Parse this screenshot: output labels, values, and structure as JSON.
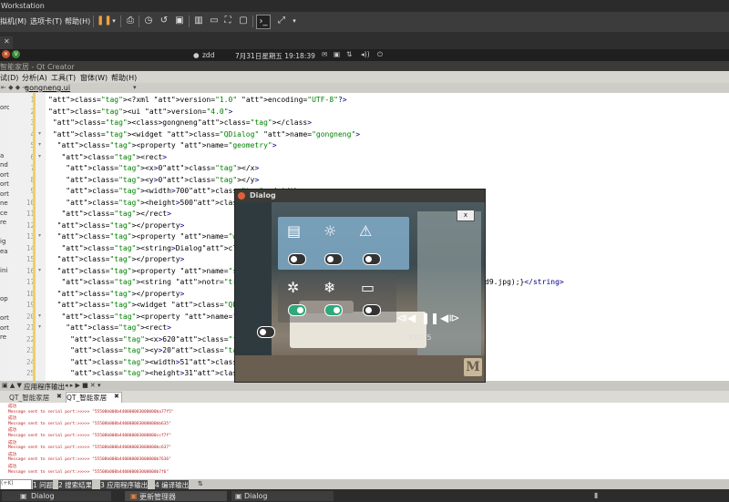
{
  "vmware": {
    "title": "Workstation",
    "menu": [
      "拟机(M)",
      "选项卡(T)",
      "帮助(H)"
    ]
  },
  "guest_panel": {
    "user": "zdd",
    "datetime": "7月31日星期五 19:18:39"
  },
  "qt": {
    "window_title": "智能家居 - Qt Creator",
    "menu": [
      "试(D)",
      "分析(A)",
      "工具(T)",
      "窗体(W)",
      "帮助(H)"
    ],
    "file_tab": "gongneng.ui",
    "left_strip": [
      "oro",
      "",
      "",
      "",
      "",
      "a",
      "nd",
      "ort",
      "ort",
      "ort",
      "ne",
      "ce",
      "re",
      "",
      "ig",
      "ea",
      "",
      "ini",
      "",
      "",
      "op",
      "",
      "ort",
      "ort",
      "re"
    ]
  },
  "code": {
    "line_numbers": [
      "1",
      "2",
      "3",
      "4",
      "5",
      "6",
      "7",
      "8",
      "9",
      "10",
      "11",
      "12",
      "13",
      "14",
      "15",
      "16",
      "17",
      "18",
      "19",
      "20",
      "21",
      "22",
      "23",
      "24",
      "25"
    ],
    "lines": [
      "<?xml version=\"1.0\" encoding=\"UTF-8\"?>",
      "<ui version=\"4.0\">",
      " <class>gongneng</class>",
      " <widget class=\"QDialog\" name=\"gongneng\">",
      "  <property name=\"geometry\">",
      "   <rect>",
      "    <x>0</x>",
      "    <y>0</y>",
      "    <width>700</width>",
      "    <height>500</height>",
      "   </rect>",
      "  </property>",
      "  <property name=\"windowTitle\">",
      "   <string>Dialog</string>",
      "  </property>",
      "  <property name=\"styleSheet\">",
      "   <string notr=\"true\">#gongneng{border-imag",
      "  </property>",
      "  <widget class=\"QPushButton\" name=\"x\">",
      "   <property name=\"geometry\">",
      "    <rect>",
      "     <x>620</x>",
      "     <y>20</y>",
      "     <width>51</width>",
      "     <height>31</height>"
    ],
    "line17_tail": "d9.jpg);}</string>"
  },
  "output": {
    "header": "应用程序输出",
    "tabs": [
      "QT_智能家居",
      "QT_智能家居"
    ],
    "lines": [
      "成功",
      "Message sent to serial port:>>>>> \"55508b000b440000003000000ba77f5\"",
      "成功",
      "Message sent to serial port:>>>>> \"55508b000b440000003000000bb635\"",
      "成功",
      "Message sent to serial port:>>>>> \"55508b000b440000003000000ccf7f\"",
      "成功",
      "Message sent to serial port:>>>>> \"55508b000b440000003000000bc637\"",
      "成功",
      "Message sent to serial port:>>>>> \"55508b000b440000003000000b7636\"",
      "成功",
      "Message sent to serial port:>>>>> \"55508b000b440000003000000b7f6\""
    ]
  },
  "status_bar": {
    "search_placeholder": "(+K)",
    "panes": [
      "1 问题",
      "2 搜索结果",
      "3 应用程序输出",
      "4 编译输出"
    ]
  },
  "taskbar": {
    "items": [
      "Dialog",
      "更新管理器",
      "Dialog"
    ]
  },
  "dialog": {
    "title": "Dialog",
    "close_label": "x",
    "overlay_text": "PM2.5",
    "watermark": "M",
    "accent_on": "#2fa87a",
    "panel_color": "#8ab8d8"
  }
}
